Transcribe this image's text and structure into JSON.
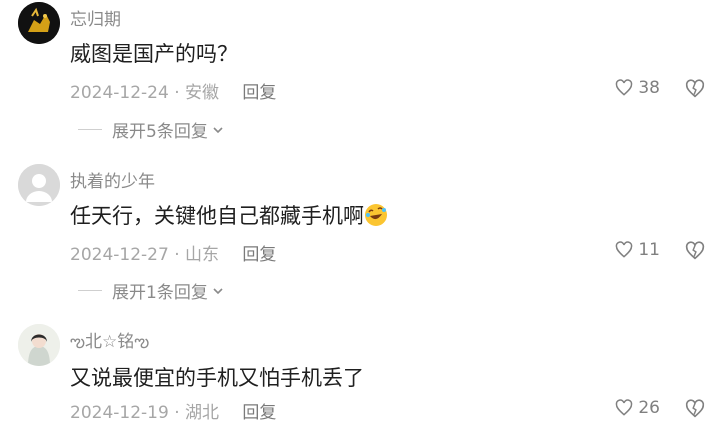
{
  "comments": [
    {
      "username": "忘归期",
      "text": "威图是国产的吗？",
      "date": "2024-12-24",
      "location": "安徽",
      "reply_label": "回复",
      "likes": "38",
      "expand_label": "展开5条回复"
    },
    {
      "username": "执着的少年",
      "text": "任天行，关键他自己都藏手机啊",
      "date": "2024-12-27",
      "location": "山东",
      "reply_label": "回复",
      "likes": "11",
      "expand_label": "展开1条回复"
    },
    {
      "username": "ఌ北☆铭ఌ",
      "text": "又说最便宜的手机又怕手机丢了",
      "date": "2024-12-19",
      "location": "湖北",
      "reply_label": "回复",
      "likes": "26"
    }
  ],
  "separator": "·",
  "icons": {
    "like": "heart-outline-icon",
    "dislike": "broken-heart-icon",
    "expand": "chevron-down-icon",
    "emoji": "rolling-laughing-emoji"
  },
  "colors": {
    "username": "#8a8a8a",
    "content": "#1f1f1f",
    "meta": "#a6a6a6"
  }
}
